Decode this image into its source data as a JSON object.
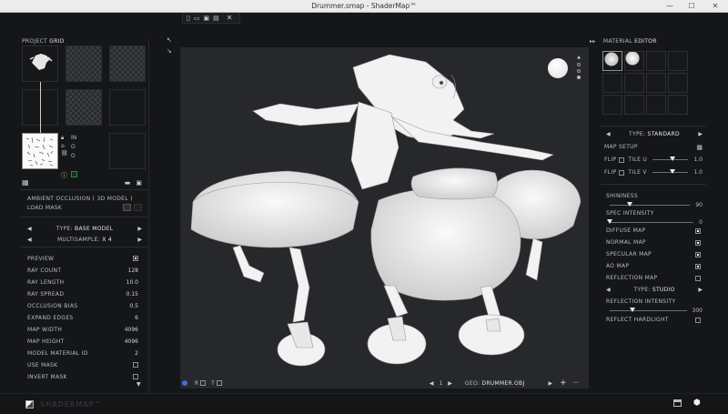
{
  "window": {
    "title": "Drummer.smap - ShaderMap™",
    "minimize": "—",
    "maximize": "☐",
    "close": "✕"
  },
  "left": {
    "project_label": "PROJECT",
    "project_name": "GRID",
    "map_props_label": "AMBIENT OCCLUSION ( 3D MODEL )",
    "load_mask": "LOAD MASK",
    "type_label": "TYPE:",
    "type_value": "BASE MODEL",
    "multisample_label": "MULTISAMPLE:",
    "multisample_value": "X 4",
    "rows": [
      {
        "label": "PREVIEW",
        "value": "",
        "checkbox": true,
        "checked": true
      },
      {
        "label": "RAY COUNT",
        "value": "128"
      },
      {
        "label": "RAY LENGTH",
        "value": "10.0"
      },
      {
        "label": "RAY SPREAD",
        "value": "0.15"
      },
      {
        "label": "OCCLUSION BIAS",
        "value": "0.5"
      },
      {
        "label": "EXPAND EDGES",
        "value": "6"
      },
      {
        "label": "MAP WIDTH",
        "value": "4096"
      },
      {
        "label": "MAP HEIGHT",
        "value": "4096"
      },
      {
        "label": "MODEL MATERIAL ID",
        "value": "2"
      },
      {
        "label": "USE MASK",
        "value": "",
        "checkbox": true,
        "checked": false
      },
      {
        "label": "INVERT MASK",
        "value": "",
        "checkbox": true,
        "checked": false
      }
    ],
    "thumb_side_labels": [
      "IN",
      "O",
      "O"
    ]
  },
  "right": {
    "header_prefix": "MATERIAL",
    "header": "EDITOR",
    "type_label": "TYPE:",
    "type_value": "STANDARD",
    "map_setup": "MAP SETUP",
    "flip_label": "FLIP",
    "tile_u": "TILE U",
    "tile_v": "TILE V",
    "tile_u_value": "1.0",
    "tile_v_value": "1.0",
    "tile_u_level": 0.55,
    "tile_v_level": 0.55,
    "shininess_label": "SHININESS",
    "shininess_value": "90",
    "shininess_level": 0.25,
    "spec_intensity_label": "SPEC INTENSITY",
    "spec_intensity_value": "0",
    "spec_intensity_level": 0.0,
    "maps": [
      {
        "label": "DIFFUSE MAP",
        "checked": true
      },
      {
        "label": "NORMAL MAP",
        "checked": true
      },
      {
        "label": "SPECULAR MAP",
        "checked": true
      },
      {
        "label": "AO MAP",
        "checked": true
      },
      {
        "label": "REFLECTION MAP",
        "checked": false
      }
    ],
    "refl_type_label": "TYPE:",
    "refl_type_value": "STUDIO",
    "refl_intensity_label": "REFLECTION INTENSITY",
    "refl_intensity_value": "300",
    "refl_intensity_level": 0.3,
    "reflect_hardlight": "REFLECT HARDLIGHT"
  },
  "viewport_bar": {
    "page": "1",
    "geo_label": "GEO:",
    "geo_value": "DRUMMER.OBJ",
    "r_label": "R",
    "t_label": "T"
  },
  "bottom": {
    "logo": "SHADERMAP™"
  },
  "colors": {
    "bg": "#151618",
    "viewport": "#27282b",
    "accent": "#ffffff"
  }
}
